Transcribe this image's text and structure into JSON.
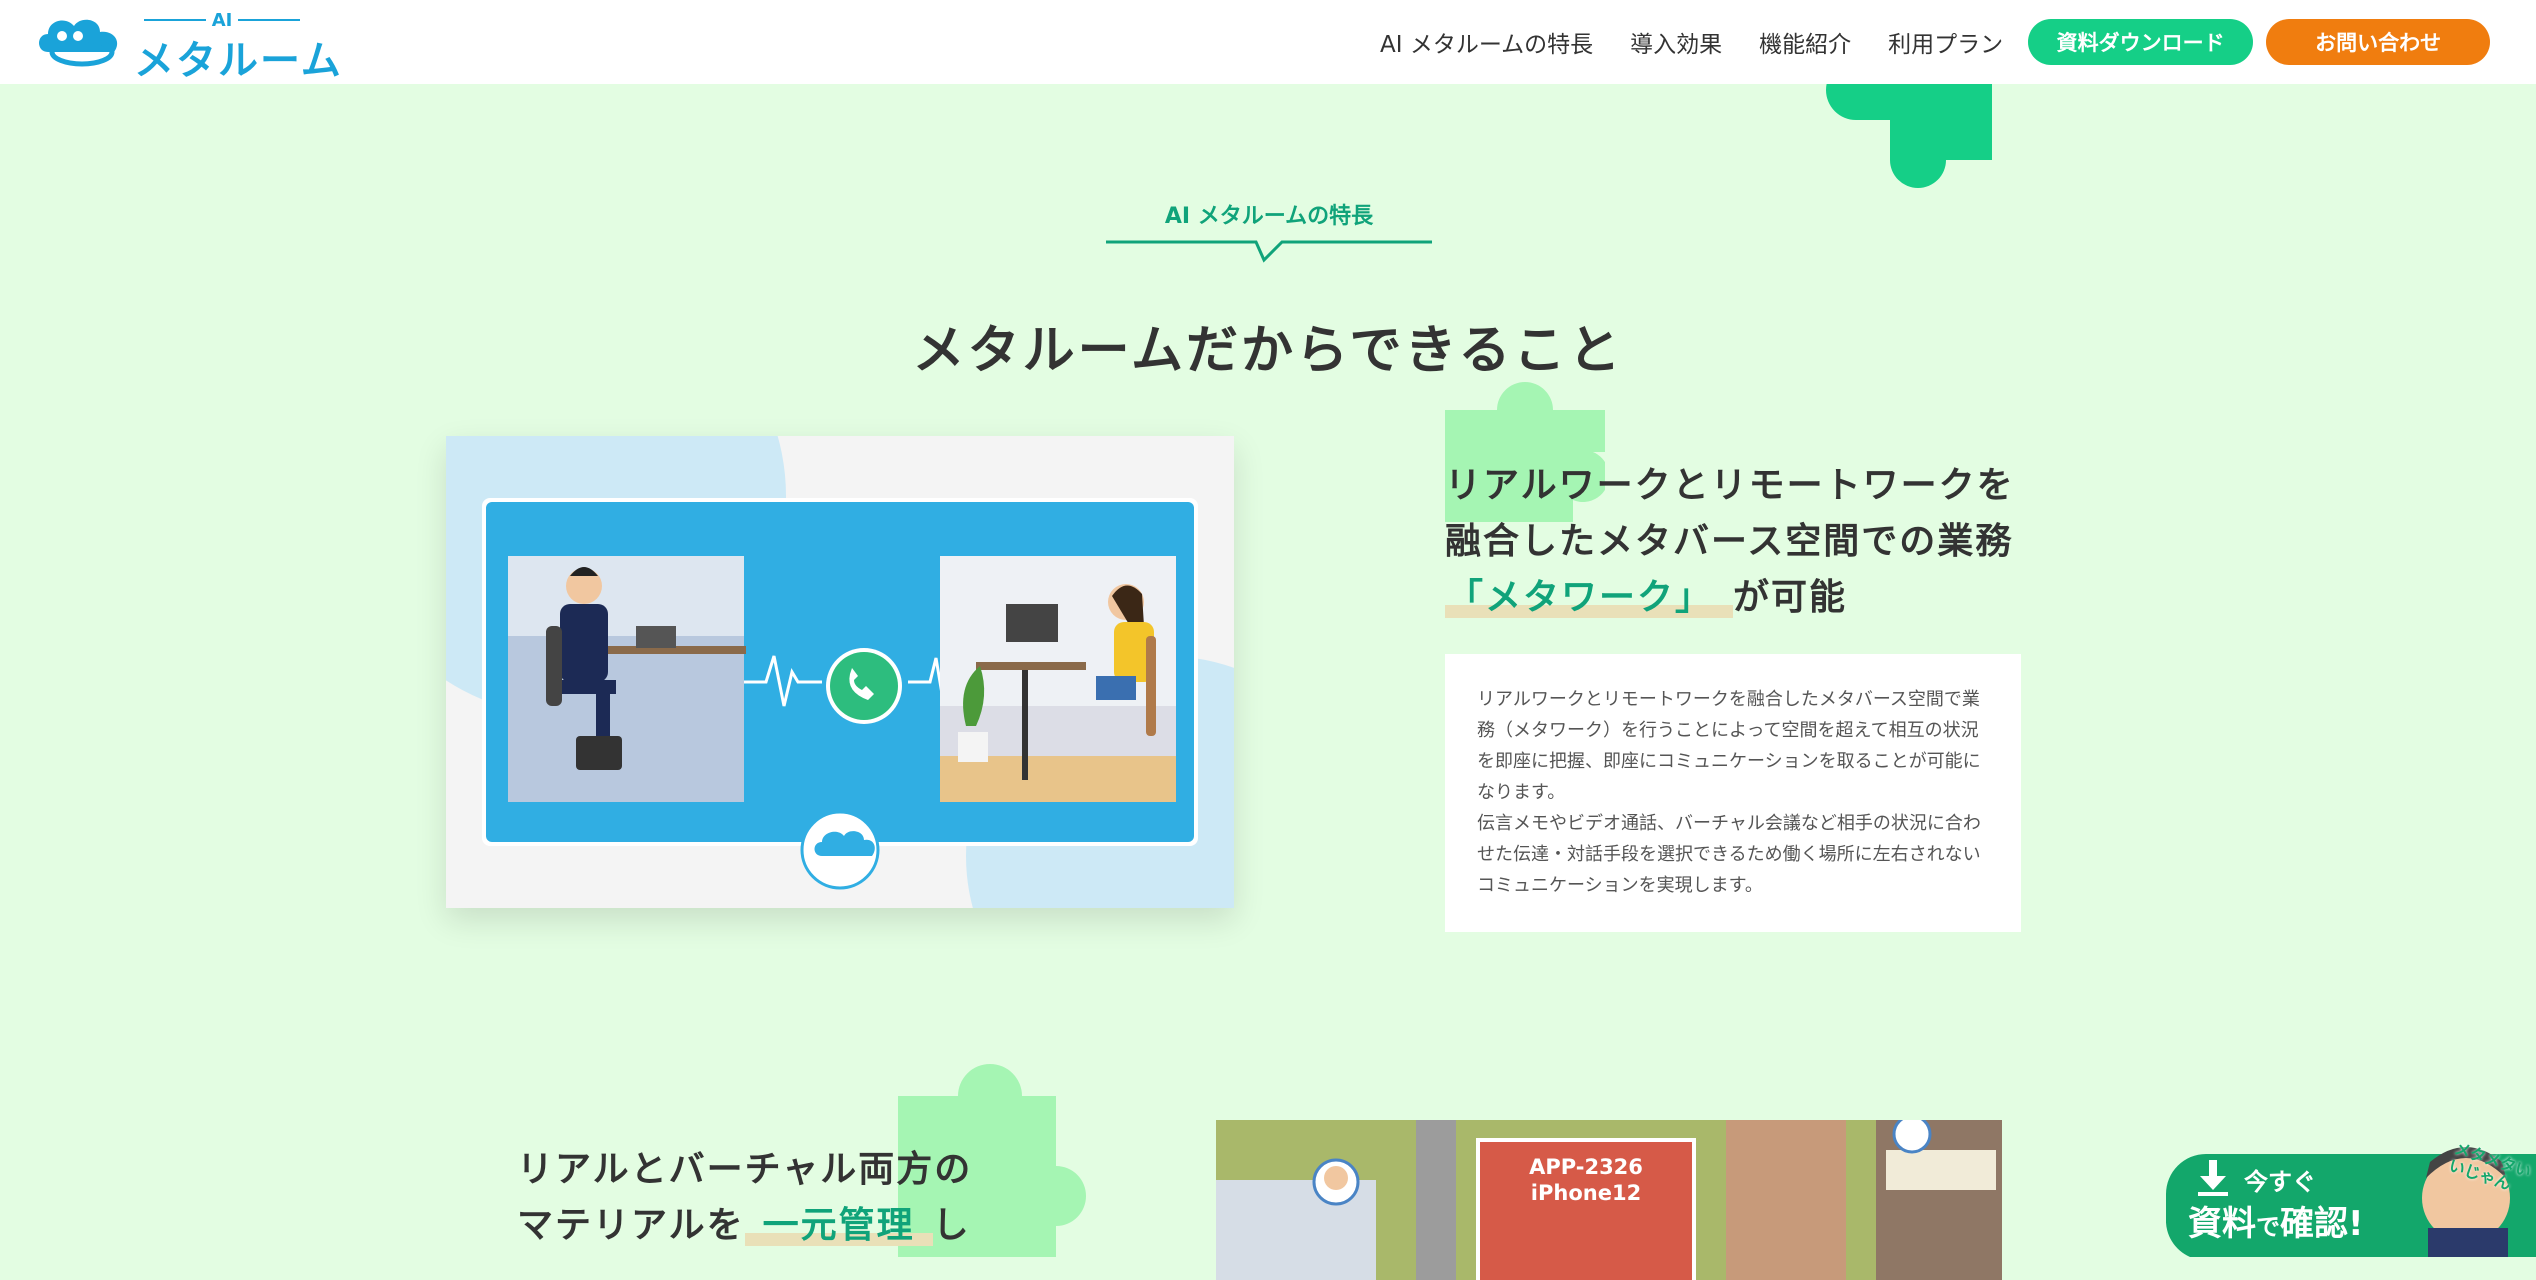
{
  "header": {
    "logo": {
      "ai_label": "AI",
      "name": "メタルーム"
    },
    "nav": [
      "AI メタルームの特長",
      "導入効果",
      "機能紹介",
      "利用プラン"
    ],
    "download_label": "資料ダウンロード",
    "contact_label": "お問い合わせ"
  },
  "section": {
    "label": "AI メタルームの特長",
    "title": "メタルームだからできること"
  },
  "feature1": {
    "heading_line1": "リアルワークとリモートワークを",
    "heading_line2": "融合したメタバース空間での業務",
    "heading_highlight": "「メタワーク」",
    "heading_suffix": "が可能",
    "paragraph1": "リアルワークとリモートワークを融合したメタバース空間で業務（メタワーク）を行うことによって空間を超えて相互の状況を即座に把握、即座にコミュニケーションを取ることが可能になります。",
    "paragraph2": "伝言メモやビデオ通話、バーチャル会議など相手の状況に合わせた伝達・対話手段を選択できるため働く場所に左右されないコミュニケーションを実現します。"
  },
  "feature2": {
    "heading_line1": "リアルとバーチャル両方の",
    "heading_line2_prefix": "マテリアルを",
    "heading_highlight": "一元管理",
    "heading_suffix": "し",
    "device_label_line1": "APP-2326",
    "device_label_line2": "iPhone12"
  },
  "banner": {
    "line1": "今すぐ",
    "line2_a": "資料",
    "line2_b": "で",
    "line2_c": "確認!",
    "bubble": "メタメタいいじゃん"
  },
  "colors": {
    "page_bg": "#e3fde2",
    "accent_green": "#15cf87",
    "accent_orange": "#f07d0f",
    "brand_blue": "#1aa3d9",
    "puzzle_green": "#a5f5b3",
    "label_green": "#10a37a"
  }
}
